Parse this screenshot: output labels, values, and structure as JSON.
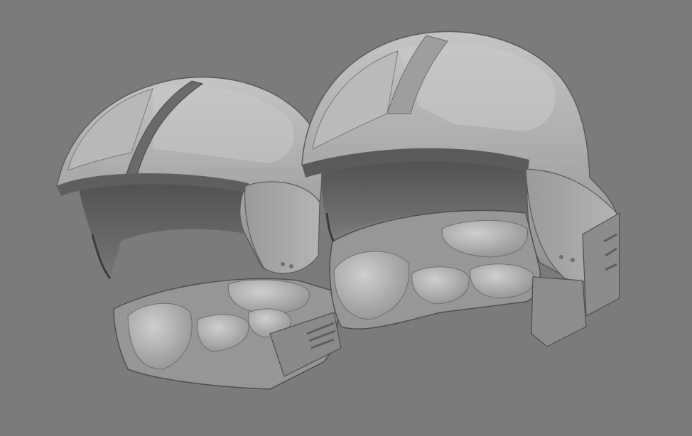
{
  "scene": {
    "background_color": "#7b7b7b",
    "shell_color": "#a9a9a9",
    "shell_highlight": "#c2c2c2",
    "shell_shadow": "#6a6a6a",
    "interior_color": "#5c5c5c",
    "padding_color": "#b5b5b5",
    "edge_color": "#3a3a3a",
    "objects": [
      {
        "id": "helmet-left",
        "icon": "helmet-icon"
      },
      {
        "id": "helmet-right",
        "icon": "helmet-icon"
      }
    ]
  }
}
